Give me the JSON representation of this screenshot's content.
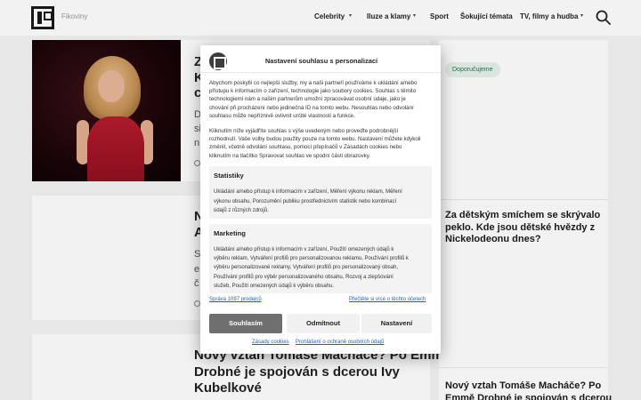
{
  "header": {
    "site_name": "Fikoviny",
    "nav": [
      {
        "label": "Celebrity",
        "has_menu": true
      },
      {
        "label": "Iluze a klamy",
        "has_menu": true
      },
      {
        "label": "Sport",
        "has_menu": false
      },
      {
        "label": "Šokující témata",
        "has_menu": false
      },
      {
        "label": "TV, filmy a hudba",
        "has_menu": true
      }
    ],
    "search_icon": "search-icon"
  },
  "articles": {
    "a1_title_frag": [
      "Z",
      "K",
      "c"
    ],
    "a1_excerpt_frag": [
      "D",
      "si",
      "n"
    ],
    "a2_title_frag": [
      "N",
      "A"
    ],
    "a2_excerpt_frag": [
      "S",
      "e",
      "č"
    ],
    "a3_title": [
      "Nový vztah Tomáše Macháče? Po Emmě",
      "Drobné je spojován s dcerou Ivy",
      "Kubelkové"
    ]
  },
  "sidebar": {
    "tag": "Doporučujeme",
    "story1_title": [
      "Za dětským smíchem se skrývalo",
      "peklo. Kde jsou dětské hvězdy z",
      "Nickelodeonu dnes?"
    ],
    "story2_title": [
      "Nový vztah Tomáše Macháče? Po",
      "Emmě Drobné je spojován s dcerou"
    ]
  },
  "consent": {
    "title": "Nastavení souhlasu s personalizací",
    "intro": [
      "Abychom poskytli co nejlepší služby, my a naši partneři používáme k ukládání a/nebo",
      "přístupu k informacím o zařízení, technologie jako soubory cookies. Souhlas s těmito",
      "technologiemi nám a našim partnerům umožní zpracovávat osobní údaje, jako je",
      "chování při procházení nebo jedinečná ID na tomto webu. Nesouhlas nebo odvolání",
      "souhlasu může nepříznivě ovlivnit určité vlastnosti a funkce."
    ],
    "instructions": [
      "Kliknutím níže vyjádříte souhlas s výše uvedeným nebo proveďte podrobnější",
      "rozhodnutí. Vaše volby budou použity pouze na tomto webu. Nastavení můžete kdykoli",
      "změnit, včetně odvolání souhlasu, pomocí přepínačů v Zásadách cookies nebo",
      "kliknutím na tlačítko Spravovat souhlas ve spodní části obrazovky."
    ],
    "statistics": {
      "title": "Statistiky",
      "text": [
        "Ukládání a/nebo přístup k informacím v zařízení, Měření výkonu reklam, Měření",
        "výkonu obsahu, Porozumění publiku prostřednictvím statistik nebo kombinací",
        "údajů z různých zdrojů."
      ]
    },
    "marketing": {
      "title": "Marketing",
      "text": [
        "Ukládání a/nebo přístup k informacím v zařízení, Použití omezených údajů k",
        "výběru reklam, Vytváření profilů pro personalizovanou reklamu, Používání profilů k",
        "výběru personalizované reklamy, Vytváření profilů pro personalizovaný obsah,",
        "Používání profilů pro výběr personalizovaného obsahu, Rozvoj a zlepšování",
        "služeb, Použití omezených údajů k výběru obsahu."
      ]
    },
    "manage_vendors": "Správa 1097 prodejců",
    "read_more": "Přečtěte si více o těchto účelech",
    "accept": "Souhlasím",
    "reject": "Odmítnout",
    "settings": "Nastavení",
    "cookie_policy": "Zásady cookies",
    "privacy_policy": "Prohlášení o ochraně osobních údajů"
  }
}
